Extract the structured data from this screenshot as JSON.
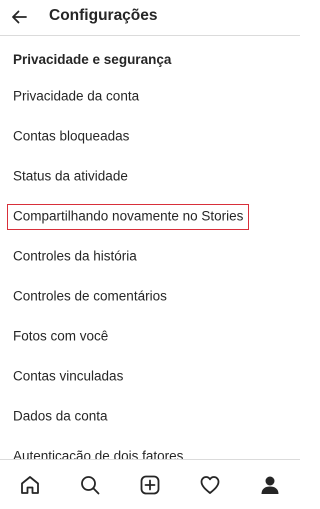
{
  "header": {
    "title": "Configurações",
    "back_icon": "arrow-left-icon"
  },
  "section": {
    "title": "Privacidade e segurança"
  },
  "menu_items": [
    {
      "label": "Privacidade da conta"
    },
    {
      "label": "Contas bloqueadas"
    },
    {
      "label": "Status da atividade"
    },
    {
      "label": "Compartilhando novamente no Stories",
      "highlighted": true
    },
    {
      "label": "Controles da história"
    },
    {
      "label": "Controles de comentários"
    },
    {
      "label": "Fotos com você"
    },
    {
      "label": "Contas vinculadas"
    },
    {
      "label": "Dados da conta"
    },
    {
      "label": "Autenticação de dois fatores"
    }
  ],
  "bottom_nav": [
    {
      "icon": "home-icon"
    },
    {
      "icon": "search-icon"
    },
    {
      "icon": "add-post-icon"
    },
    {
      "icon": "heart-icon"
    },
    {
      "icon": "profile-icon",
      "active": true
    }
  ],
  "colors": {
    "text": "#262626",
    "divider": "#dbdbdb",
    "highlight": "#d82f3a"
  }
}
